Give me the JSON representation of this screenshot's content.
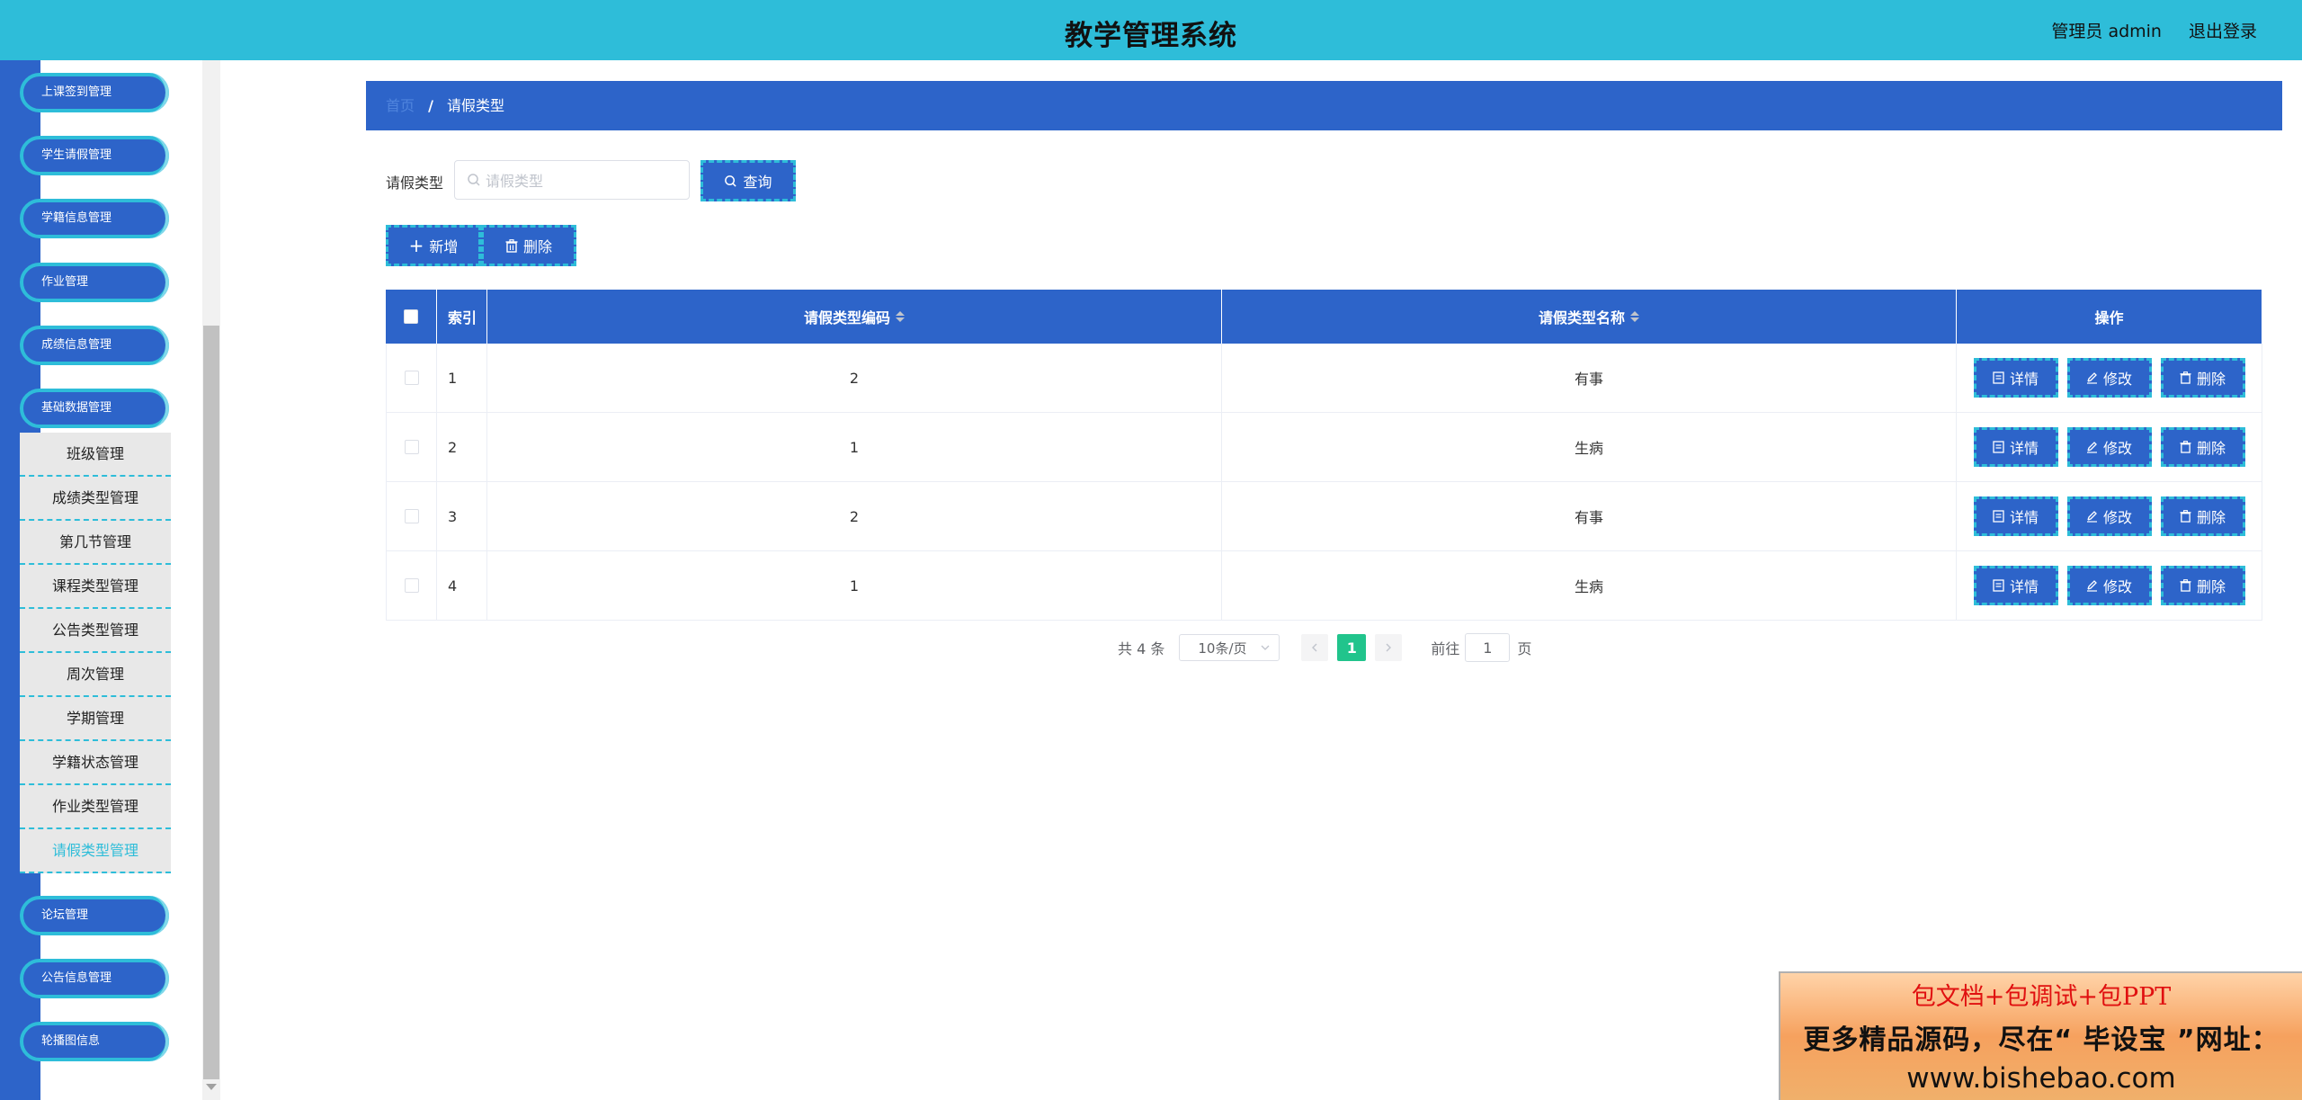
{
  "header": {
    "title": "教学管理系统",
    "user_label": "管理员 admin",
    "logout_label": "退出登录"
  },
  "sidebar": {
    "top_items": [
      {
        "label": "上课签到管理"
      },
      {
        "label": "学生请假管理"
      },
      {
        "label": "学籍信息管理"
      },
      {
        "label": "作业管理"
      },
      {
        "label": "成绩信息管理"
      },
      {
        "label": "基础数据管理"
      }
    ],
    "sub_items": [
      {
        "label": "班级管理"
      },
      {
        "label": "成绩类型管理"
      },
      {
        "label": "第几节管理"
      },
      {
        "label": "课程类型管理"
      },
      {
        "label": "公告类型管理"
      },
      {
        "label": "周次管理"
      },
      {
        "label": "学期管理"
      },
      {
        "label": "学籍状态管理"
      },
      {
        "label": "作业类型管理"
      },
      {
        "label": "请假类型管理"
      }
    ],
    "active_sub": "请假类型管理",
    "bottom_items": [
      {
        "label": "论坛管理"
      },
      {
        "label": "公告信息管理"
      },
      {
        "label": "轮播图信息"
      }
    ]
  },
  "breadcrumb": {
    "home": "首页",
    "separator": "/",
    "current": "请假类型"
  },
  "search": {
    "label": "请假类型",
    "placeholder": "请假类型",
    "value": "",
    "query_label": "查询"
  },
  "toolbar": {
    "add_label": "新增",
    "delete_label": "删除"
  },
  "table": {
    "columns": [
      "索引",
      "请假类型编码",
      "请假类型名称",
      "操作"
    ],
    "rows": [
      {
        "index": "1",
        "code": "2",
        "name": "有事"
      },
      {
        "index": "2",
        "code": "1",
        "name": "生病"
      },
      {
        "index": "3",
        "code": "2",
        "name": "有事"
      },
      {
        "index": "4",
        "code": "1",
        "name": "生病"
      }
    ],
    "actions": {
      "detail": "详情",
      "edit": "修改",
      "delete": "删除"
    }
  },
  "pagination": {
    "total_text": "共 4 条",
    "page_size": "10条/页",
    "current_page": "1",
    "goto_prefix": "前往",
    "goto_value": "1",
    "goto_suffix": "页"
  },
  "promo": {
    "line1": "包文档+包调试+包PPT",
    "line2": "更多精品源码，尽在“ 毕设宝 ”网址：",
    "line3": "www.bishebao.com"
  },
  "colors": {
    "header_bg": "#2ebdd9",
    "primary": "#2d64c9",
    "accent": "#2ebdd9",
    "page_active": "#21c48c"
  }
}
